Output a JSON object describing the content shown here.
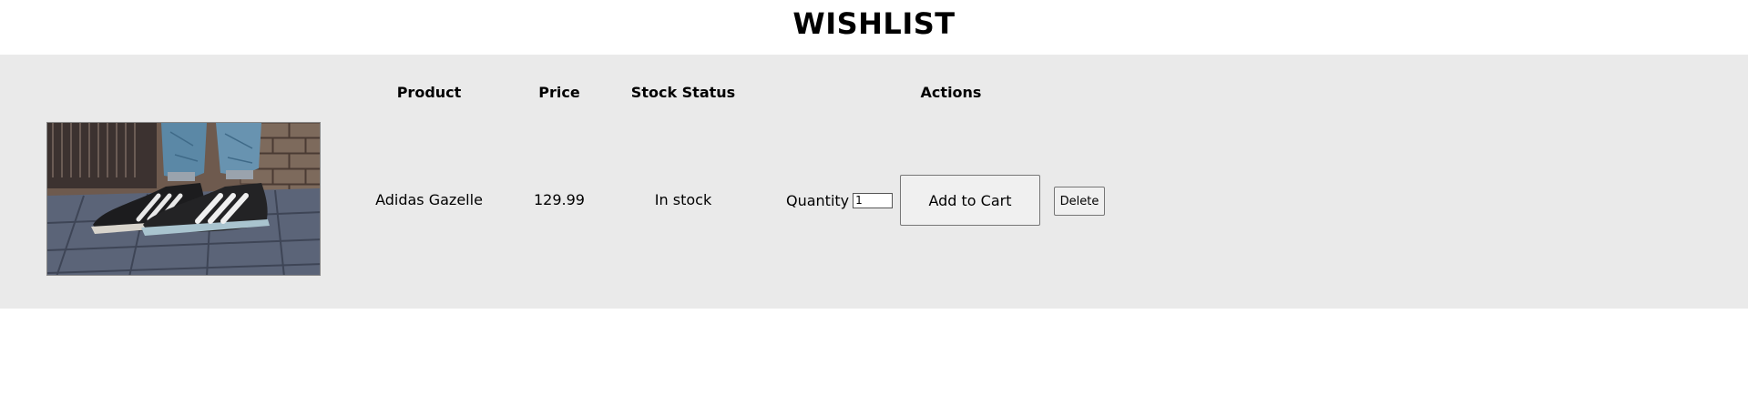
{
  "page": {
    "title": "WISHLIST"
  },
  "table": {
    "headers": {
      "product": "Product",
      "price": "Price",
      "stock_status": "Stock Status",
      "actions": "Actions"
    },
    "rows": [
      {
        "product_name": "Adidas Gazelle",
        "price": "129.99",
        "stock_status": "In stock",
        "quantity_label": "Quantity",
        "quantity_value": "1",
        "add_to_cart_label": "Add to Cart",
        "delete_label": "Delete"
      }
    ]
  },
  "colors": {
    "panel_background": "#eaeaea",
    "button_background": "#f0f0f0"
  }
}
